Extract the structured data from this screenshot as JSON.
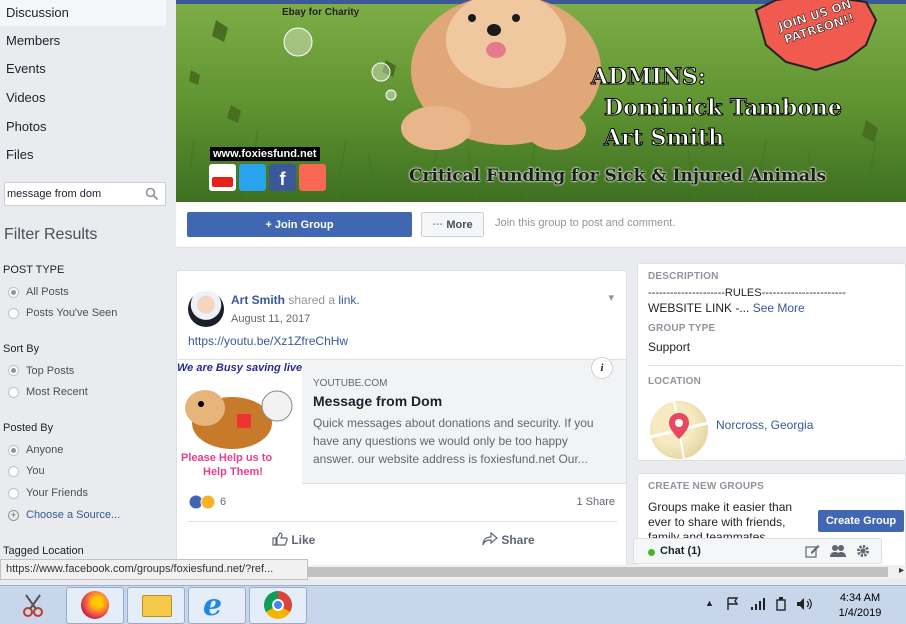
{
  "sidebar": {
    "nav": [
      "Discussion",
      "Members",
      "Events",
      "Videos",
      "Photos",
      "Files"
    ],
    "search_value": "message from dom",
    "filter_title": "Filter Results",
    "post_type": {
      "heading": "POST TYPE",
      "options": [
        "All Posts",
        "Posts You've Seen"
      ],
      "selected": "All Posts"
    },
    "sort_by": {
      "heading": "Sort By",
      "options": [
        "Top Posts",
        "Most Recent"
      ],
      "selected": "Top Posts"
    },
    "posted_by": {
      "heading": "Posted By",
      "options": [
        "Anyone",
        "You",
        "Your Friends"
      ],
      "selected": "Anyone",
      "choose": "Choose a Source..."
    },
    "tagged_location": "Tagged Location"
  },
  "cover": {
    "ebay": "Ebay for Charity",
    "patreon": "JOIN US ON PATREON!!",
    "admins_label": "ADMINS:",
    "admin_names": [
      "Dominick Tambone",
      "Art Smith"
    ],
    "website": "www.foxiesfund.net",
    "social": [
      "YouTube",
      "Twitter",
      "Facebook",
      "Patreon"
    ],
    "tagline": "Critical Funding for Sick & Injured Animals"
  },
  "actions": {
    "join": "+ Join Group",
    "more": "More",
    "hint": "Join this group to post and comment."
  },
  "post": {
    "author": "Art Smith",
    "verb": "shared a",
    "object": "link.",
    "date": "August 11, 2017",
    "url": "https://youtu.be/Xz1ZfreChHw",
    "preview": {
      "thumb_top": "We are Busy saving live",
      "thumb_bottom1": "Please Help us to",
      "thumb_bottom2": "Help Them!",
      "domain": "YOUTUBE.COM",
      "title": "Message from Dom",
      "description": "Quick messages about donations and security. If you have any questions we would only be too happy answer. our website address is foxiesfund.net Our..."
    },
    "reaction_count": "6",
    "shares": "1 Share",
    "like": "Like",
    "share": "Share"
  },
  "about": {
    "description_heading": "DESCRIPTION",
    "description_line1": "---------------------RULES-----------------------",
    "description_line2": "WEBSITE LINK -...",
    "see_more": "See More",
    "group_type_heading": "GROUP TYPE",
    "group_type": "Support",
    "location_heading": "LOCATION",
    "location": "Norcross, Georgia",
    "create_heading": "CREATE NEW GROUPS",
    "create_text": "Groups make it easier than ever to share with friends, family and teammates.",
    "create_button": "Create Group"
  },
  "chat": {
    "label": "Chat (1)",
    "status_color": "#42b72a"
  },
  "status_url": "https://www.facebook.com/groups/foxiesfund.net/?ref...",
  "clock": {
    "time": "4:34 AM",
    "date": "1/4/2019"
  },
  "colors": {
    "fb_blue": "#4267b2",
    "link": "#385898",
    "bg": "#e9ebee"
  }
}
